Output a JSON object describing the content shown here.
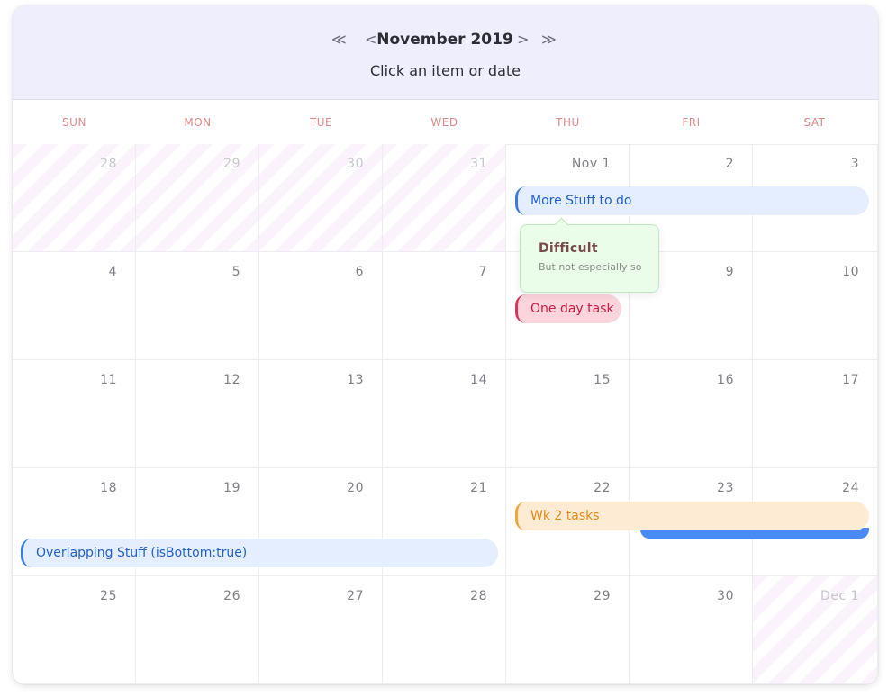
{
  "header": {
    "prev_year": "≪",
    "prev_month": "<",
    "title": "November 2019",
    "next_month": ">",
    "next_year": "≫",
    "subtitle": "Click an item or date"
  },
  "weekdays": [
    "SUN",
    "MON",
    "TUE",
    "WED",
    "THU",
    "FRI",
    "SAT"
  ],
  "weeks": [
    [
      {
        "d": "28",
        "out": true
      },
      {
        "d": "29",
        "out": true
      },
      {
        "d": "30",
        "out": true
      },
      {
        "d": "31",
        "out": true
      },
      {
        "d": "Nov 1",
        "out": false
      },
      {
        "d": "2",
        "out": false
      },
      {
        "d": "3",
        "out": false
      }
    ],
    [
      {
        "d": "4",
        "out": false
      },
      {
        "d": "5",
        "out": false
      },
      {
        "d": "6",
        "out": false
      },
      {
        "d": "7",
        "out": false
      },
      {
        "d": "8",
        "out": false
      },
      {
        "d": "9",
        "out": false
      },
      {
        "d": "10",
        "out": false
      }
    ],
    [
      {
        "d": "11",
        "out": false
      },
      {
        "d": "12",
        "out": false
      },
      {
        "d": "13",
        "out": false
      },
      {
        "d": "14",
        "out": false
      },
      {
        "d": "15",
        "out": false
      },
      {
        "d": "16",
        "out": false
      },
      {
        "d": "17",
        "out": false
      }
    ],
    [
      {
        "d": "18",
        "out": false
      },
      {
        "d": "19",
        "out": false
      },
      {
        "d": "20",
        "out": false
      },
      {
        "d": "21",
        "out": false
      },
      {
        "d": "22",
        "out": false
      },
      {
        "d": "23",
        "out": false
      },
      {
        "d": "24",
        "out": false
      }
    ],
    [
      {
        "d": "25",
        "out": false
      },
      {
        "d": "26",
        "out": false
      },
      {
        "d": "27",
        "out": false
      },
      {
        "d": "28",
        "out": false
      },
      {
        "d": "29",
        "out": false
      },
      {
        "d": "30",
        "out": false
      },
      {
        "d": "Dec 1",
        "out": true
      }
    ]
  ],
  "events": {
    "more_stuff": "More Stuff to do",
    "one_day": "One day task",
    "wk2": "Wk 2 tasks",
    "overlapping": "Overlapping Stuff (isBottom:true)"
  },
  "tooltip": {
    "title": "Difficult",
    "subtitle": "But not especially so"
  },
  "colors": {
    "header_bg": "#efeefd",
    "weekday_text": "#e08a8a",
    "event_blue": "#e4eeff",
    "event_pink": "#fcd4dc",
    "event_orange": "#fdebd3",
    "tooltip_bg": "#eafde9"
  }
}
